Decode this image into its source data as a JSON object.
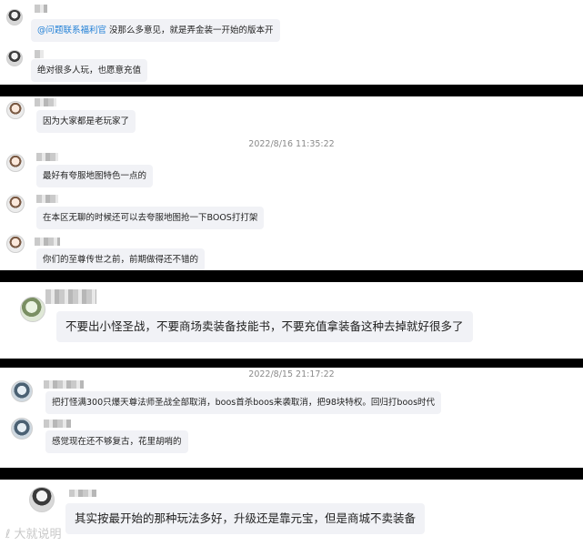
{
  "groups": [
    {
      "messages": [
        {
          "mention": "@问题联系福利官",
          "text": " 没那么多意见，就是弄金装一开始的版本开"
        },
        {
          "text": "绝对很多人玩，也愿意充值"
        }
      ]
    },
    {
      "messages": [
        {
          "text": "因为大家都是老玩家了"
        },
        {
          "text": "最好有夸服地图特色一点的"
        },
        {
          "text": "在本区无聊的时候还可以去夸服地图抢一下BOOS打打架"
        },
        {
          "text": "你们的至尊传世之前，前期做得还不错的"
        }
      ],
      "timestamp": "2022/8/16 11:35:22"
    },
    {
      "messages": [
        {
          "text": "不要出小怪圣战，不要商场卖装备技能书，不要充值拿装备这种去掉就好很多了"
        }
      ]
    },
    {
      "timestamp": "2022/8/15 21:17:22",
      "messages": [
        {
          "text": "把打怪满300只爆天尊法师圣战全部取消，boos首杀boos来袭取消，把98块特权。回归打boos时代"
        },
        {
          "text": "感觉现在还不够复古，花里胡哨的"
        }
      ]
    },
    {
      "messages": [
        {
          "text": "其实按最开始的那种玩法多好，升级还是靠元宝，但是商城不卖装备"
        }
      ]
    }
  ],
  "watermark": "大就说明"
}
